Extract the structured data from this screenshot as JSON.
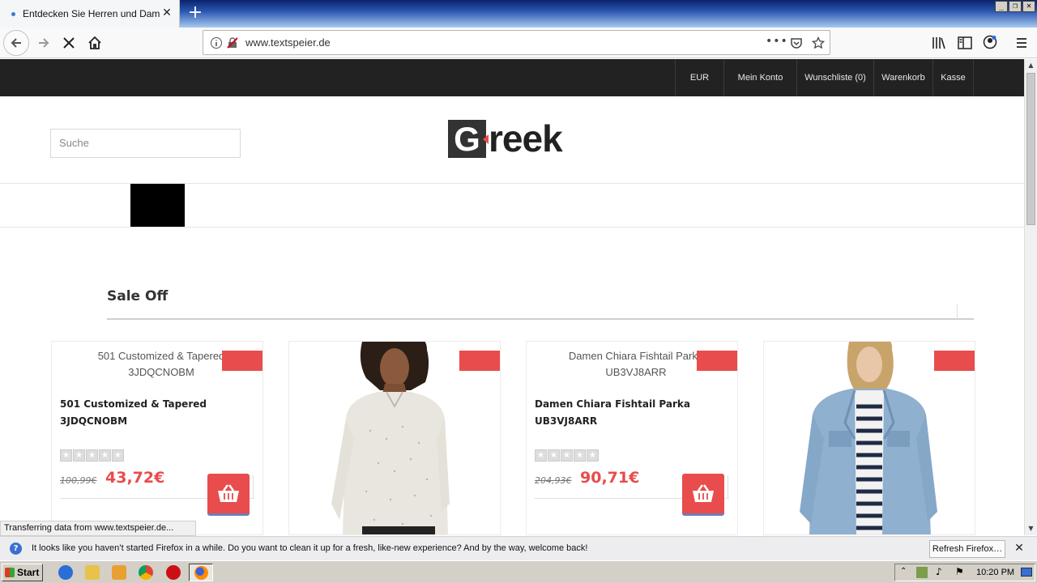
{
  "browser": {
    "tab_title": "Entdecken Sie Herren und Damen",
    "url": "www.textspeier.de",
    "status_text": "Transferring data from www.textspeier.de...",
    "notification": "It looks like you haven’t started Firefox in a while. Do you want to clean it up for a fresh, like-new experience? And by the way, welcome back!",
    "refresh_button": "Refresh Firefox…"
  },
  "topbar": {
    "items": [
      "EUR",
      "Mein Konto",
      "Wunschliste (0)",
      "Warenkorb",
      "Kasse"
    ]
  },
  "search": {
    "placeholder": "Suche"
  },
  "logo": {
    "letter": "G",
    "rest": "reek"
  },
  "section": {
    "title": "Sale Off"
  },
  "products": [
    {
      "alt": "501 Customized & Tapered 3JDQCNOBM",
      "name": "501 Customized & Tapered 3JDQCNOBM",
      "old_price": "100,99€",
      "new_price": "43,72€",
      "image": "none"
    },
    {
      "alt": "",
      "name": "",
      "old_price": "",
      "new_price": "",
      "image": "blouse-photo"
    },
    {
      "alt": "Damen Chiara Fishtail Parka UB3VJ8ARR",
      "name": "Damen Chiara Fishtail Parka UB3VJ8ARR",
      "old_price": "204,93€",
      "new_price": "90,71€",
      "image": "none"
    },
    {
      "alt": "",
      "name": "",
      "old_price": "",
      "new_price": "",
      "image": "denim-jacket-photo"
    }
  ],
  "taskbar": {
    "start": "Start",
    "clock": "10:20 PM"
  },
  "colors": {
    "accent": "#e84c4c",
    "topbar": "#222222"
  }
}
